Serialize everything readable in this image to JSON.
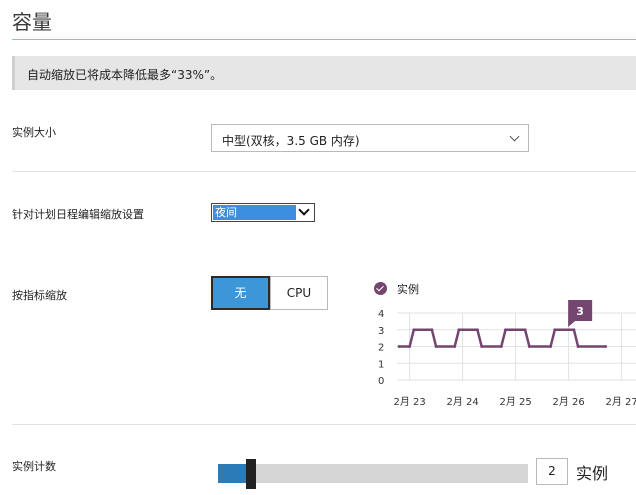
{
  "page": {
    "title": "容量"
  },
  "notice": {
    "text": "自动缩放已将成本降低最多“33%”。"
  },
  "instance_size": {
    "label": "实例大小",
    "selected": "中型(双核，3.5 GB 内存)"
  },
  "schedule": {
    "label": "针对计划日程编辑缩放设置",
    "selected": "夜间"
  },
  "scale_by_metric": {
    "label": "按指标缩放",
    "options": [
      "无",
      "CPU"
    ],
    "selected": "无"
  },
  "chart_data": {
    "type": "line",
    "legend": "实例",
    "x_ticks": [
      "2月 23",
      "2月 24",
      "2月 25",
      "2月 26",
      "2月 27"
    ],
    "y_ticks": [
      "0",
      "1",
      "2",
      "3",
      "4"
    ],
    "ylim": [
      0,
      4
    ],
    "series": [
      {
        "name": "实例",
        "color": "#74456f",
        "points": [
          [
            0.0,
            2
          ],
          [
            0.2,
            2
          ],
          [
            0.28,
            3
          ],
          [
            0.62,
            3
          ],
          [
            0.7,
            2
          ],
          [
            1.05,
            2
          ],
          [
            1.13,
            3
          ],
          [
            1.48,
            3
          ],
          [
            1.56,
            2
          ],
          [
            1.93,
            2
          ],
          [
            2.01,
            3
          ],
          [
            2.38,
            3
          ],
          [
            2.46,
            2
          ],
          [
            2.86,
            2
          ],
          [
            2.94,
            3
          ],
          [
            3.3,
            3
          ],
          [
            3.38,
            2
          ],
          [
            3.9,
            2
          ]
        ]
      }
    ],
    "annotation": "3",
    "grid": true
  },
  "instance_count": {
    "label": "实例计数",
    "value": "2",
    "unit": "实例",
    "slider_fraction": 0.09
  }
}
